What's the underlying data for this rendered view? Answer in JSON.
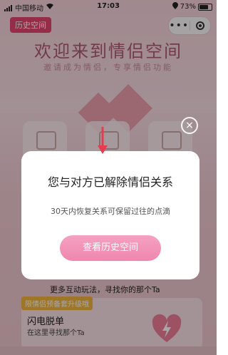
{
  "status": {
    "carrier": "中国移动",
    "time": "17:03",
    "battery": "73%"
  },
  "header": {
    "history_tag": "历史空间"
  },
  "hero": {
    "title": "欢迎来到情侣空间",
    "subtitle": "邀请成为情侣，专享情侣功能"
  },
  "features": [
    {
      "icon": "video-icon"
    },
    {
      "icon": "photo-icon"
    },
    {
      "icon": "calendar-icon"
    }
  ],
  "content": {
    "caption": "更多互动玩法，寻找你的那个Ta",
    "promo_tag": "限情侣预备套升级哦",
    "promo_title": "闪电脱单",
    "promo_desc": "在这里寻找那个Ta"
  },
  "modal": {
    "title": "您与对方已解除情侣关系",
    "desc": "30天内恢复关系可保留过往的点滴",
    "button": "查看历史空间",
    "close": "×"
  }
}
